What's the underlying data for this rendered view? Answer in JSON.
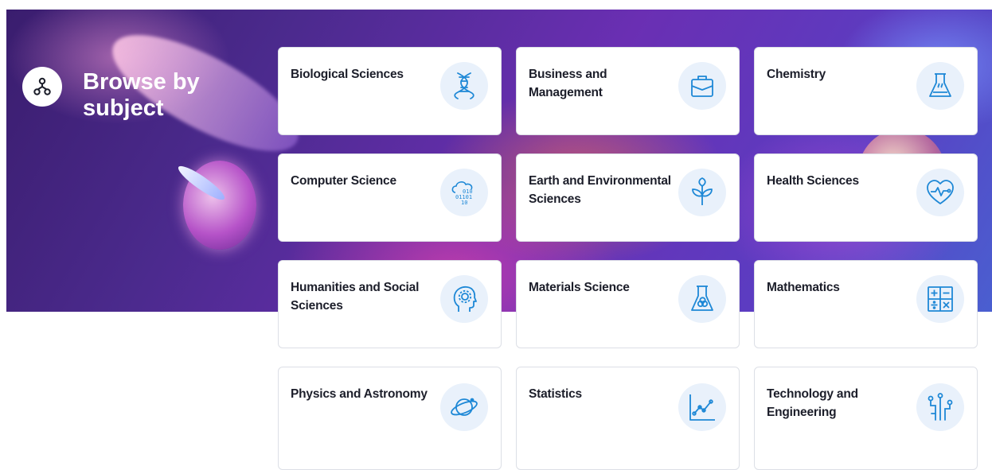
{
  "hero": {
    "title": "Browse by subject",
    "icon": "network-nodes-icon"
  },
  "colors": {
    "accent": "#1e88d6",
    "icon_bg": "#e9f1fb",
    "card_text": "#1c1e2a"
  },
  "subjects": [
    {
      "label": "Biological Sciences",
      "icon": "dna-icon"
    },
    {
      "label": "Business and Management",
      "icon": "briefcase-icon"
    },
    {
      "label": "Chemistry",
      "icon": "flask-icon"
    },
    {
      "label": "Computer Science",
      "icon": "cloud-binary-icon"
    },
    {
      "label": "Earth and Environmental Sciences",
      "icon": "plant-icon"
    },
    {
      "label": "Health Sciences",
      "icon": "heart-pulse-icon"
    },
    {
      "label": "Humanities and Social Sciences",
      "icon": "head-gear-icon"
    },
    {
      "label": "Materials Science",
      "icon": "beaker-molecules-icon"
    },
    {
      "label": "Mathematics",
      "icon": "calculator-symbols-icon"
    },
    {
      "label": "Physics and Astronomy",
      "icon": "planet-icon"
    },
    {
      "label": "Statistics",
      "icon": "line-chart-icon"
    },
    {
      "label": "Technology and Engineering",
      "icon": "circuit-icon"
    }
  ]
}
